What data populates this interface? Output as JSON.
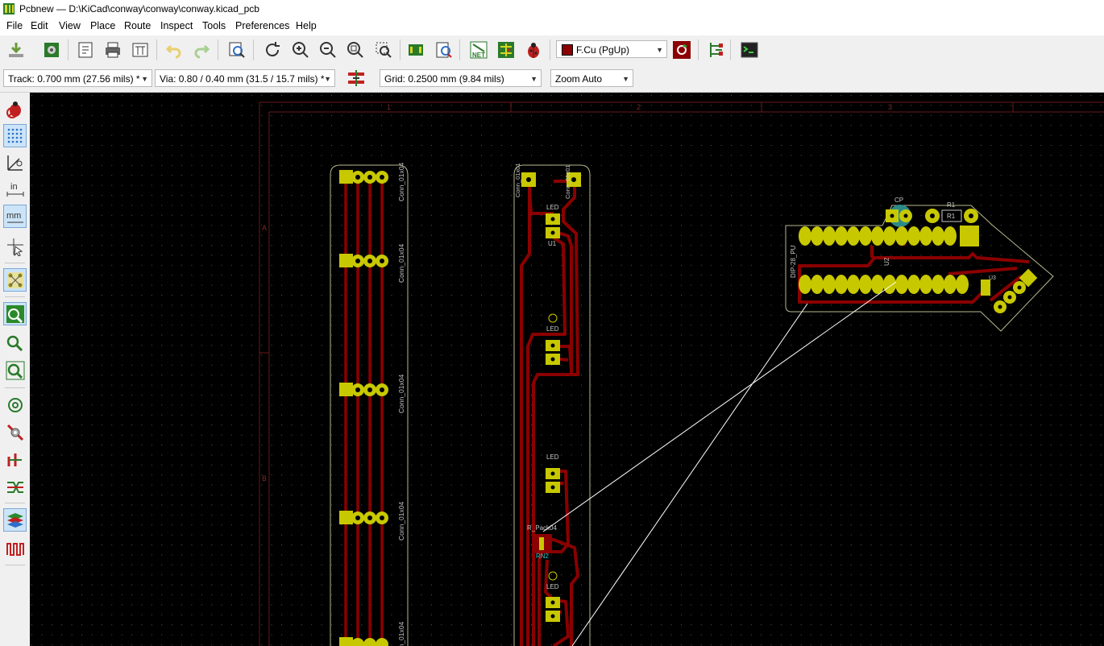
{
  "window": {
    "title": "Pcbnew — D:\\KiCad\\conway\\conway\\conway.kicad_pcb"
  },
  "menu": [
    "File",
    "Edit",
    "View",
    "Place",
    "Route",
    "Inspect",
    "Tools",
    "Preferences",
    "Help"
  ],
  "toolbar": {
    "layer_select": "F.Cu (PgUp)",
    "net_icon_label": "NET",
    "track_width": "Track: 0.700 mm (27.56 mils) *",
    "via_size": "Via: 0.80 / 0.40 mm (31.5 / 15.7 mils) *",
    "grid": "Grid: 0.2500 mm (9.84 mils)",
    "zoom": "Zoom Auto"
  },
  "left_toolbar": {
    "inch_label": "in",
    "mm_label": "mm"
  },
  "board": {
    "sheet_columns": [
      "1",
      "2",
      "3"
    ],
    "sheet_rows": [
      "A",
      "B"
    ],
    "labels": {
      "conn": "Conn_01x04",
      "conn_single": "Conn_01x01",
      "led": "LED",
      "u1": "U1",
      "rn": "R_Pack04",
      "rn2": "RN2",
      "cp": "CP",
      "r1": "R1",
      "u2": "U2",
      "dip": "DIP-28_PU",
      "u3": "U3"
    }
  },
  "colors": {
    "copper": "#8b0000",
    "pad": "#c8c800",
    "edge": "#b8b890",
    "silk": "#c8c8c8",
    "ratsnest": "#ffffff",
    "accent": "#2e6fc7"
  }
}
